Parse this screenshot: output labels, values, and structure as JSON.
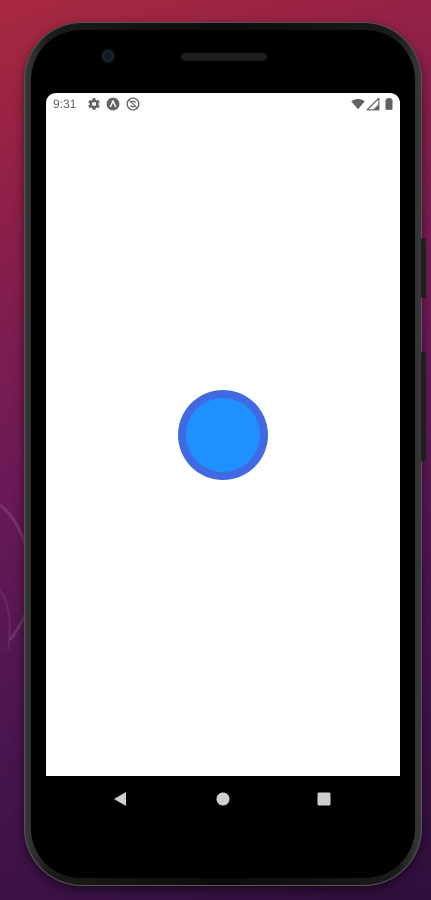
{
  "status_bar": {
    "time": "9:31",
    "left_icons": [
      "gear-icon",
      "a-circle-icon",
      "sync-disabled-icon"
    ],
    "right_icons": [
      "wifi-icon",
      "signal-icon",
      "battery-icon"
    ]
  },
  "main": {
    "record_button": {
      "icon": "circle",
      "outer_color": "#4169e1",
      "inner_color": "#1e90ff"
    }
  },
  "nav_bar": {
    "items": [
      "back-icon",
      "home-icon",
      "recents-icon"
    ]
  },
  "colors": {
    "screen_background": "#ffffff",
    "status_icon_color": "#5f6368",
    "nav_icon_color": "#cfcfcf"
  }
}
